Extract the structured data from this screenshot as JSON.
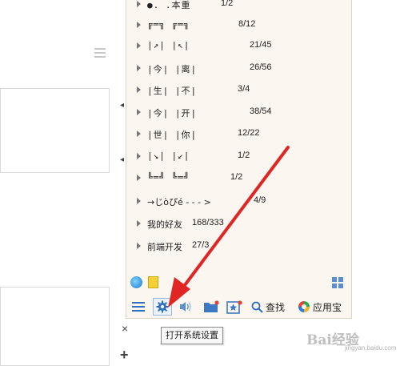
{
  "background_app": {
    "close_label": "×",
    "add_label": "+"
  },
  "friend_list": {
    "groups": [
      {
        "name": "●. .本重",
        "count": "1/2"
      },
      {
        "name": "╔═╗ ╔═╗",
        "count": "8/12"
      },
      {
        "name": "|↗|  |↖|",
        "count": "21/45"
      },
      {
        "name": "|今|  |离|",
        "count": "26/56"
      },
      {
        "name": "|生|  |不|",
        "count": "3/4"
      },
      {
        "name": "|今|  |开|",
        "count": "38/54"
      },
      {
        "name": "|世|  |你|",
        "count": "12/22"
      },
      {
        "name": "|↘|  |↙|",
        "count": "1/2"
      },
      {
        "name": "╚═╝ ╚═╝",
        "count": "1/2"
      },
      {
        "name": "→じòぴé - - -  >",
        "count": "4/9"
      },
      {
        "name": "我的好友",
        "count": "168/333"
      },
      {
        "name": "前端开发",
        "count": "27/3"
      }
    ]
  },
  "toolbar": {
    "search_label": "查找",
    "app_label": "应用宝"
  },
  "tooltip": {
    "text": "打开系统设置"
  },
  "watermark": {
    "text": "Bai经验",
    "sub": "jingyan.baidu.com"
  },
  "colors": {
    "panel_bg": "#fbf6ef",
    "accent_blue": "#2e6fc0",
    "annotation_red": "#e02525"
  }
}
